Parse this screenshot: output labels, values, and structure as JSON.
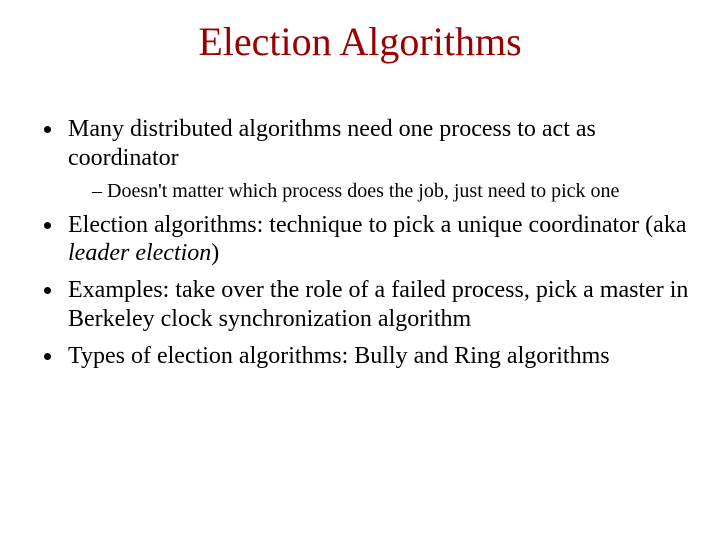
{
  "title": {
    "text": "Election Algorithms",
    "color": "#990000"
  },
  "bullets": [
    {
      "text": "Many distributed algorithms need one process to act as coordinator",
      "sub": [
        {
          "text": "Doesn't matter which process does the job, just need to pick one"
        }
      ]
    },
    {
      "parts": [
        {
          "text": "Election algorithms: technique to pick a unique coordinator (aka "
        },
        {
          "text": "leader election",
          "italic": true
        },
        {
          "text": ")"
        }
      ]
    },
    {
      "text": "Examples: take over the role of a failed process, pick a master in Berkeley clock synchronization algorithm"
    },
    {
      "text": "Types of election algorithms: Bully and Ring algorithms"
    }
  ]
}
